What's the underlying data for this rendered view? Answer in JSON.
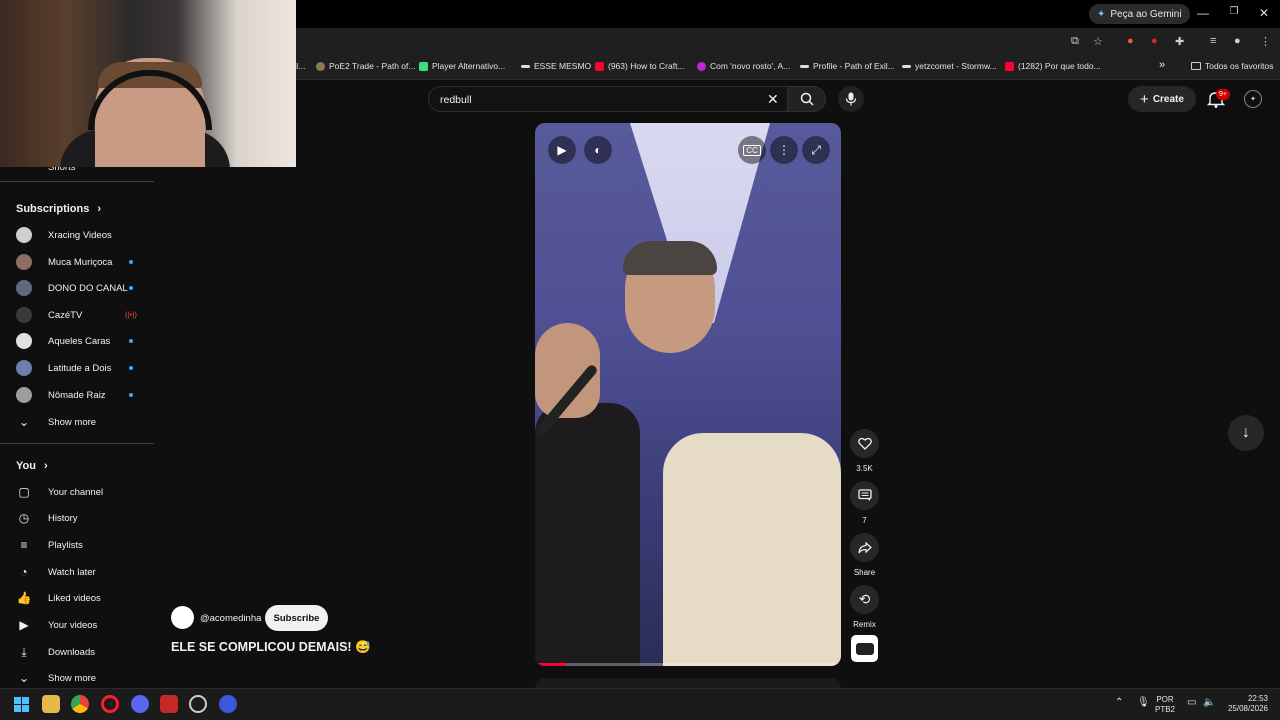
{
  "browser": {
    "gemini_label": "Peça ao Gemini",
    "bookmarks": [
      {
        "label": "PoE2 Trade - Path of...",
        "color": "#8a7a50"
      },
      {
        "label": "Player Alternativo...",
        "color": "#3ddc84"
      },
      {
        "label": "ESSE MESMO",
        "color": "#dddddd"
      },
      {
        "label": "(963) How to Craft...",
        "color": "#ff0033"
      },
      {
        "label": "Com 'novo rosto', A...",
        "color": "#c026d3"
      },
      {
        "label": "Profile - Path of Exil...",
        "color": "#dddddd"
      },
      {
        "label": "yetzcomet - Stormw...",
        "color": "#dddddd"
      },
      {
        "label": "(1282) Por que todo...",
        "color": "#ff0033"
      }
    ],
    "bookmarks_overflow": "»",
    "all_bookmarks": "Todos os favoritos"
  },
  "header": {
    "search_value": "redbull",
    "create_label": "Create",
    "notifications_badge": "9+"
  },
  "sidebar": {
    "partial_item": "Shorts",
    "subscriptions_title": "Subscriptions",
    "subscriptions": [
      {
        "label": "Xracing Videos",
        "avatar": "#cfcfcf",
        "status": "none"
      },
      {
        "label": "Muca Muriçoca",
        "avatar": "#8d6e63",
        "status": "new"
      },
      {
        "label": "DONO DO CANAL",
        "avatar": "#5c6b7a",
        "status": "new"
      },
      {
        "label": "CazéTV",
        "avatar": "#3a3a3a",
        "status": "live"
      },
      {
        "label": "Aqueles Caras",
        "avatar": "#e0e0e0",
        "status": "new"
      },
      {
        "label": "Latitude a Dois",
        "avatar": "#6b7fa8",
        "status": "new"
      },
      {
        "label": "Nômade Raiz",
        "avatar": "#9e9e9e",
        "status": "new"
      }
    ],
    "live_indicator": "((•))",
    "show_more_1": "Show more",
    "you_title": "You",
    "you_items": [
      {
        "label": "Your channel",
        "icon": "channel-icon"
      },
      {
        "label": "History",
        "icon": "history-icon"
      },
      {
        "label": "Playlists",
        "icon": "playlists-icon"
      },
      {
        "label": "Watch later",
        "icon": "watch-later-icon"
      },
      {
        "label": "Liked videos",
        "icon": "thumbs-up-icon"
      },
      {
        "label": "Your videos",
        "icon": "your-videos-icon"
      },
      {
        "label": "Downloads",
        "icon": "download-icon"
      }
    ],
    "show_more_2": "Show more"
  },
  "short": {
    "channel_handle": "@acomedinha",
    "subscribe_label": "Subscribe",
    "title": "ELE SE COMPLICOU DEMAIS! 😅",
    "progress": 0.1,
    "likes": "3.5K",
    "comments": "7",
    "share_label": "Share",
    "remix_label": "Remix"
  },
  "taskbar": {
    "lang_top": "POR",
    "lang_bottom": "PTB2",
    "time": "22:53",
    "date": "25/08/2026"
  }
}
